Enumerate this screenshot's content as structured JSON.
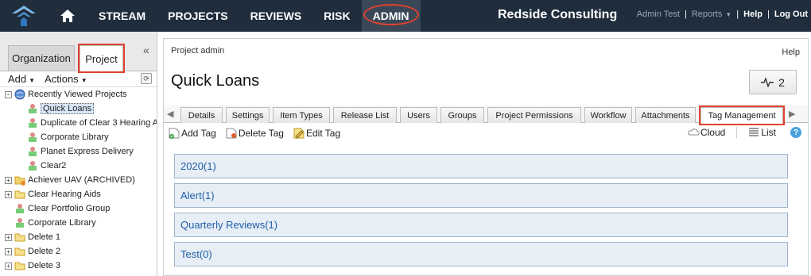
{
  "nav": {
    "items": [
      "STREAM",
      "PROJECTS",
      "REVIEWS",
      "RISK",
      "ADMIN"
    ],
    "company": "Redside Consulting",
    "user": "Admin Test",
    "reports": "Reports",
    "help": "Help",
    "logout": "Log Out"
  },
  "left": {
    "tabs": [
      "Organization",
      "Project"
    ],
    "add": "Add",
    "actions": "Actions",
    "tree": [
      "Recently Viewed Projects",
      "Quick Loans",
      "Duplicate of Clear 3 Hearing A",
      "Corporate Library",
      "Planet Express Delivery",
      "Clear2",
      "Achiever UAV (ARCHIVED)",
      "Clear Hearing Aids",
      "Clear Portfolio Group",
      "Corporate Library",
      "Delete 1",
      "Delete 2",
      "Delete 3"
    ]
  },
  "main": {
    "breadcrumb": "Project admin",
    "help": "Help",
    "title": "Quick Loans",
    "pulse_count": "2",
    "tabs": [
      "Details",
      "Settings",
      "Item Types",
      "Release List",
      "Users",
      "Groups",
      "Project Permissions",
      "Workflow",
      "Attachments",
      "Tag Management"
    ],
    "actions": {
      "add_tag": "Add Tag",
      "delete_tag": "Delete Tag",
      "edit_tag": "Edit Tag",
      "cloud": "Cloud",
      "list": "List"
    },
    "tags": [
      "2020(1)",
      "Alert(1)",
      "Quarterly Reviews(1)",
      "Test(0)"
    ]
  },
  "colors": {
    "nav_bg": "#1f2d3d",
    "highlight": "#e0412f",
    "tag_text": "#1f5fa8",
    "tag_bg": "#e7eef6"
  }
}
